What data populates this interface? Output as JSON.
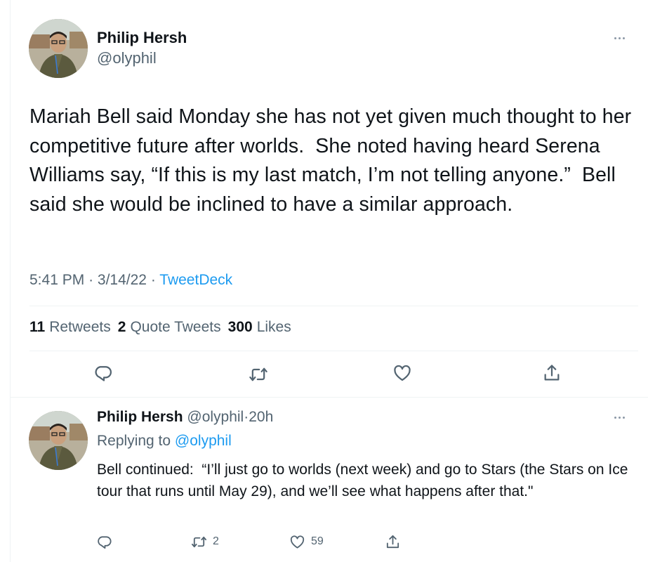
{
  "main_tweet": {
    "author": {
      "name": "Philip Hersh",
      "handle": "@olyphil"
    },
    "text": "Mariah Bell said Monday she has not yet given much thought to her competitive future after worlds.  She noted having heard Serena Williams say, “If this is my last match, I’m not telling anyone.”  Bell said she would be inclined to have a similar approach.",
    "time": "5:41 PM",
    "date": "3/14/22",
    "source": "TweetDeck",
    "separator": "·",
    "stats": {
      "retweets": {
        "count": "11",
        "label": "Retweets"
      },
      "quotes": {
        "count": "2",
        "label": "Quote Tweets"
      },
      "likes": {
        "count": "300",
        "label": "Likes"
      }
    },
    "actions": [
      "reply-icon",
      "retweet-icon",
      "like-icon",
      "share-icon"
    ]
  },
  "reply_tweet": {
    "author": {
      "name": "Philip Hersh",
      "handle": "@olyphil",
      "age": "20h"
    },
    "separator": "·",
    "replying_prefix": "Replying to",
    "replying_to": "@olyphil",
    "text": "Bell continued:  “I’ll just go to worlds (next week) and go to Stars (the Stars on Ice tour that runs until May 29), and we’ll see what happens after that.\"",
    "counts": {
      "reply": "",
      "retweet": "2",
      "like": "59"
    }
  },
  "colors": {
    "text": "#0f1419",
    "secondary": "#536471",
    "link": "#1d9bf0",
    "divider": "#eff3f4"
  }
}
